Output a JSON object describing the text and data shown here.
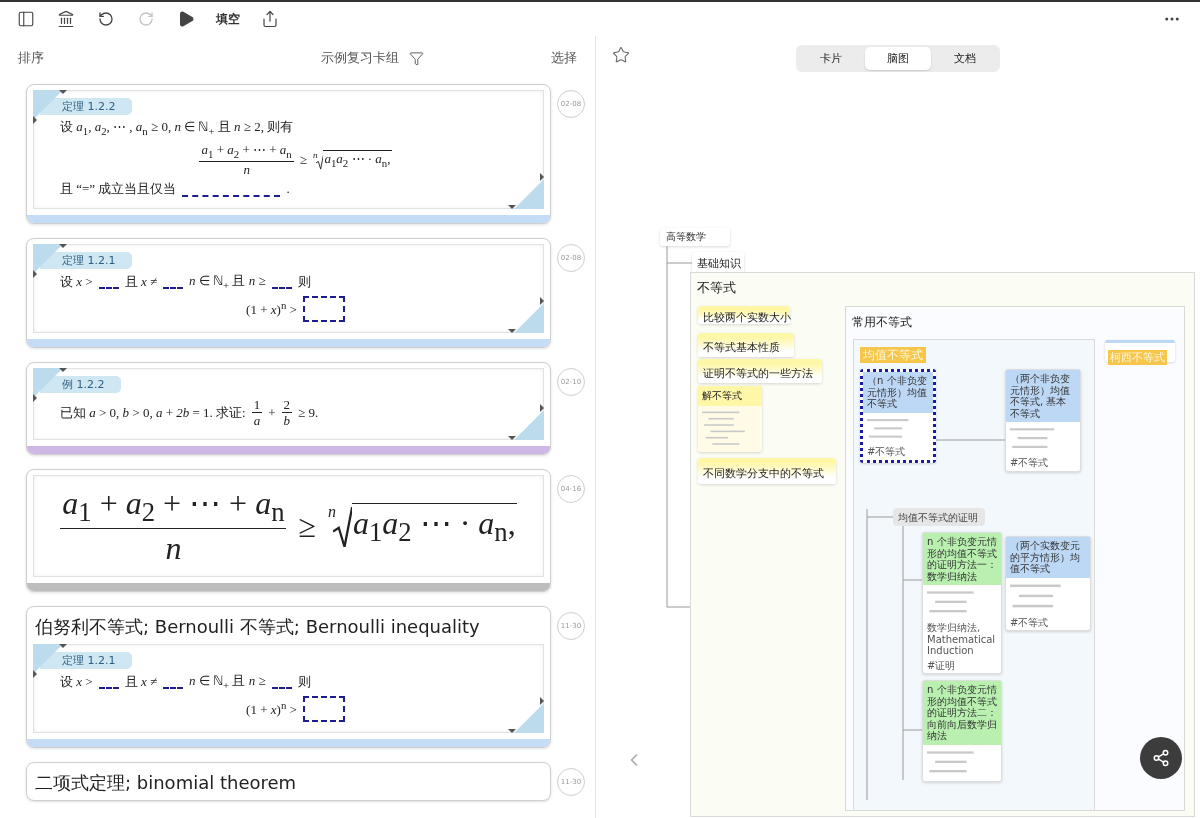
{
  "toolbar": {
    "undo": {
      "disabled": false
    },
    "redo": {
      "disabled": true
    },
    "mode_label": "填空"
  },
  "list_header": {
    "sort": "排序",
    "deck": "示例复习卡组",
    "select": "选择"
  },
  "cards": [
    {
      "kind": "note",
      "date": "02-08",
      "color": "#c5dcf7",
      "tag": "定理 1.2.2",
      "lines": [
        {
          "display": false,
          "segs": [
            {
              "kind": "text",
              "text": "设 *a*$_{1}$, *a*$_{2}$, ⋯ , *a*$_{n}$ ≥ 0, *n* ∈ ℕ$_{+}$ 且 *n* ≥ 2, 则有"
            }
          ]
        },
        {
          "display": true,
          "segs": [
            {
              "kind": "frac",
              "num": "*a*$_{1}$ + *a*$_{2}$ + ⋯ + *a*$_{n}$",
              "den": "*n*"
            },
            {
              "kind": "text",
              "text": "≥"
            },
            {
              "kind": "root",
              "index": "*n*",
              "radicand": "*a*$_{1}$*a*$_{2}$ ⋯ · *a*$_{n}$,"
            }
          ]
        },
        {
          "display": false,
          "segs": [
            {
              "kind": "text",
              "text": "且 “=” 成立当且仅当"
            },
            {
              "kind": "blank",
              "long": true
            },
            {
              "kind": "text",
              "text": "."
            }
          ]
        }
      ]
    },
    {
      "kind": "note",
      "date": "02-08",
      "color": "#c5dcf7",
      "tag": "定理 1.2.1",
      "lines": [
        {
          "display": false,
          "segs": [
            {
              "kind": "text",
              "text": "设 *x* >"
            },
            {
              "kind": "blank",
              "long": false
            },
            {
              "kind": "text",
              "text": "且 *x* ≠"
            },
            {
              "kind": "blank",
              "long": false
            },
            {
              "kind": "text",
              "text": "*n* ∈ ℕ$_{+}$ 且 *n* ≥"
            },
            {
              "kind": "blank",
              "long": false
            },
            {
              "kind": "text",
              "text": "则"
            }
          ]
        },
        {
          "display": true,
          "segs": [
            {
              "kind": "text",
              "text": "(1 + *x*)$^{n}$ >"
            },
            {
              "kind": "box"
            }
          ]
        }
      ]
    },
    {
      "kind": "note",
      "date": "02-10",
      "color": "#cdb8e6",
      "tag": "例 1.2.2",
      "lines": [
        {
          "display": false,
          "segs": [
            {
              "kind": "text",
              "text": "已知 *a* > 0, *b* > 0, *a* + *2b* = 1. 求证:"
            },
            {
              "kind": "frac",
              "num": "1",
              "den": "*a*"
            },
            {
              "kind": "text",
              "text": "+"
            },
            {
              "kind": "frac",
              "num": "2",
              "den": "*b*"
            },
            {
              "kind": "text",
              "text": "≥ 9."
            }
          ]
        }
      ]
    },
    {
      "kind": "formula",
      "date": "04-16",
      "color": "#bdbdbd",
      "lines": [
        {
          "display": true,
          "segs": [
            {
              "kind": "frac",
              "num": "*a*$_{1}$ + *a*$_{2}$ + ⋯ + *a*$_{n}$",
              "den": "*n*"
            },
            {
              "kind": "text",
              "text": "≥"
            },
            {
              "kind": "root",
              "index": "*n*",
              "radicand": "*a*$_{1}$*a*$_{2}$ ⋯ · *a*$_{n}$,"
            }
          ]
        }
      ]
    },
    {
      "kind": "note",
      "date": "11-30",
      "color": "#c5dcf7",
      "title": "伯努利不等式; Bernoulli 不等式; Bernoulli inequality",
      "tag": "定理 1.2.1",
      "lines": [
        {
          "display": false,
          "segs": [
            {
              "kind": "text",
              "text": "设 *x* >"
            },
            {
              "kind": "blank",
              "long": false
            },
            {
              "kind": "text",
              "text": "且 *x* ≠"
            },
            {
              "kind": "blank",
              "long": false
            },
            {
              "kind": "text",
              "text": "*n* ∈ ℕ$_{+}$ 且 *n* ≥"
            },
            {
              "kind": "blank",
              "long": false
            },
            {
              "kind": "text",
              "text": "则"
            }
          ]
        },
        {
          "display": true,
          "segs": [
            {
              "kind": "text",
              "text": "(1 + *x*)$^{n}$ >"
            },
            {
              "kind": "box"
            }
          ]
        }
      ]
    },
    {
      "kind": "note",
      "date": "11-30",
      "title": "二项式定理; binomial theorem"
    }
  ],
  "view_tabs": [
    {
      "label": "卡片",
      "selected": false
    },
    {
      "label": "脑图",
      "selected": true
    },
    {
      "label": "文档",
      "selected": false
    }
  ],
  "mindmap": {
    "kind": "root",
    "text": "高等数学",
    "children": [
      {
        "kind": "topic",
        "text": "基础知识",
        "children": [
          {
            "kind": "container",
            "text": "不等式",
            "children": [
              {
                "kind": "topic",
                "text": "比较两个实数大小",
                "color": "#fff7a8"
              },
              {
                "kind": "topic",
                "text": "不等式基本性质",
                "color": "#fff7a8"
              },
              {
                "kind": "topic",
                "text": "证明不等式的一些方法",
                "color": "#fff7a8"
              },
              {
                "kind": "note",
                "text": "解不等式"
              },
              {
                "kind": "topic",
                "text": "不同数学分支中的不等式",
                "color": "#fff7a8"
              },
              {
                "kind": "container",
                "text": "常用不等式",
                "children": [
                  {
                    "kind": "container",
                    "text": "均值不等式",
                    "highlight": true,
                    "children": [
                      {
                        "kind": "card",
                        "text": "（n 个非负变元情形）均值不等式",
                        "color": "#bcd8f5",
                        "selected": true,
                        "footer": [
                          "#不等式"
                        ]
                      },
                      {
                        "kind": "label",
                        "text": "均值不等式的证明",
                        "children": [
                          {
                            "kind": "card",
                            "text": "n 个非负变元情形的均值不等式的证明方法一：数学归纳法",
                            "color": "#b9f0b0",
                            "selected": false,
                            "footer": [
                              "数学归纳法, Mathematical Induction",
                              "#证明"
                            ]
                          },
                          {
                            "kind": "card",
                            "text": "n 个非负变元情形的均值不等式的证明方法二：向前向后数学归纳法",
                            "color": "#b9f0b0",
                            "selected": false
                          }
                        ]
                      },
                      {
                        "kind": "card",
                        "text": "（两个非负变元情形）均值不等式, 基本不等式",
                        "color": "#bcd8f5",
                        "selected": false,
                        "footer": [
                          "#不等式"
                        ]
                      },
                      {
                        "kind": "card",
                        "text": "（两个实数变元的平方情形）均值不等式",
                        "color": "#bcd8f5",
                        "selected": false,
                        "footer": [
                          "#不等式"
                        ]
                      }
                    ]
                  },
                  {
                    "kind": "topic",
                    "text": "柯西不等式",
                    "highlight": true
                  }
                ]
              }
            ]
          }
        ]
      }
    ]
  }
}
